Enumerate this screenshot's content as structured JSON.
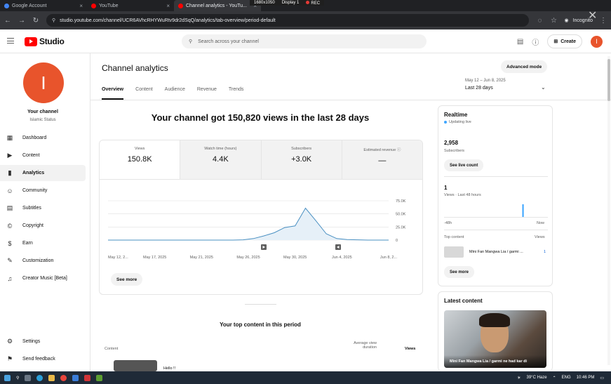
{
  "browser": {
    "tabs": [
      {
        "label": "Google Account",
        "color": "#4285f4"
      },
      {
        "label": "YouTube",
        "color": "#ff0000"
      },
      {
        "label": "Channel analytics - YouTu...",
        "color": "#ff0000"
      }
    ],
    "overlay": {
      "resolution": "1680x1050",
      "display": "Display 1",
      "rec": "REC"
    },
    "url": "studio.youtube.com/channel/UCR6AVhcRHYWuRtv9dr2dSqQ/analytics/tab-overview/period-default",
    "incognito": "Incognito"
  },
  "header": {
    "logo": "Studio",
    "search_placeholder": "Search across your channel",
    "create": "Create",
    "avatar_letter": "I"
  },
  "sidebar": {
    "avatar_letter": "I",
    "your_channel": "Your channel",
    "channel_name": "Islamic Status",
    "items": [
      {
        "label": "Dashboard",
        "icon": "▦"
      },
      {
        "label": "Content",
        "icon": "▶"
      },
      {
        "label": "Analytics",
        "icon": "▮"
      },
      {
        "label": "Community",
        "icon": "☺"
      },
      {
        "label": "Subtitles",
        "icon": "▤"
      },
      {
        "label": "Copyright",
        "icon": "©"
      },
      {
        "label": "Earn",
        "icon": "$"
      },
      {
        "label": "Customization",
        "icon": "✎"
      },
      {
        "label": "Creator Music [Beta]",
        "icon": "♫"
      }
    ],
    "bottom": [
      {
        "label": "Settings",
        "icon": "⚙"
      },
      {
        "label": "Send feedback",
        "icon": "⚑"
      }
    ]
  },
  "main": {
    "title": "Channel analytics",
    "advanced_mode": "Advanced mode",
    "tabs": [
      "Overview",
      "Content",
      "Audience",
      "Revenue",
      "Trends"
    ],
    "date_range": "May 12 – Jun 8, 2025",
    "date_label": "Last 28 days",
    "headline": "Your channel got 150,820 views in the last 28 days",
    "metrics": [
      {
        "label": "Views",
        "value": "150.8K"
      },
      {
        "label": "Watch time (hours)",
        "value": "4.4K"
      },
      {
        "label": "Subscribers",
        "value": "+3.0K"
      },
      {
        "label": "Estimated revenue",
        "value": "—"
      }
    ],
    "see_more": "See more",
    "top_content_title": "Your top content in this period",
    "table_headers": {
      "content": "Content",
      "avg": "Average view duration",
      "views": "Views"
    },
    "top_row_title": "Hello !!"
  },
  "chart_data": {
    "type": "area",
    "x": [
      "May 12, 2...",
      "May 17, 2025",
      "May 21, 2025",
      "May 26, 2025",
      "May 30, 2025",
      "Jun 4, 2025",
      "Jun 8, 2..."
    ],
    "yticks": [
      "75.0K",
      "50.0K",
      "25.0K",
      "0"
    ],
    "ylim": [
      0,
      75000
    ],
    "series": [
      {
        "values": [
          0,
          0,
          0,
          0,
          0,
          0,
          0,
          0,
          0,
          0,
          0,
          0,
          0,
          500,
          3000,
          8000,
          14000,
          24000,
          27000,
          61000,
          37000,
          12000,
          3000,
          1000,
          500,
          0,
          0,
          0
        ]
      }
    ],
    "color": "#4a90c2",
    "grid": true
  },
  "realtime": {
    "title": "Realtime",
    "live": "Updating live",
    "subs": "2,958",
    "subs_label": "Subscribers",
    "see_live": "See live count",
    "views": "1",
    "views_label": "Views · Last 48 hours",
    "bars": [
      0,
      0,
      0,
      0,
      0,
      0,
      0,
      0,
      0,
      0,
      0,
      0,
      0,
      0,
      0,
      0,
      0,
      0,
      0,
      0,
      0,
      0,
      0,
      0,
      0,
      0,
      0,
      0,
      0,
      0,
      0,
      0,
      0,
      0,
      0,
      0,
      1,
      0,
      0,
      0,
      0,
      0,
      0,
      0,
      0,
      0,
      0,
      0
    ],
    "axis_left": "-48h",
    "axis_right": "Now",
    "top_content": "Top content",
    "views_col": "Views",
    "top_item": "Mini Fan Mangwa Lia / garmi ...",
    "top_item_views": "1",
    "see_more": "See more"
  },
  "latest": {
    "title": "Latest content",
    "caption": "Mini Fan Mangwa Lia / garmi ne had kar di"
  },
  "taskbar": {
    "weather": "39°C  Haze",
    "lang": "ENG",
    "time": "10:46 PM"
  }
}
